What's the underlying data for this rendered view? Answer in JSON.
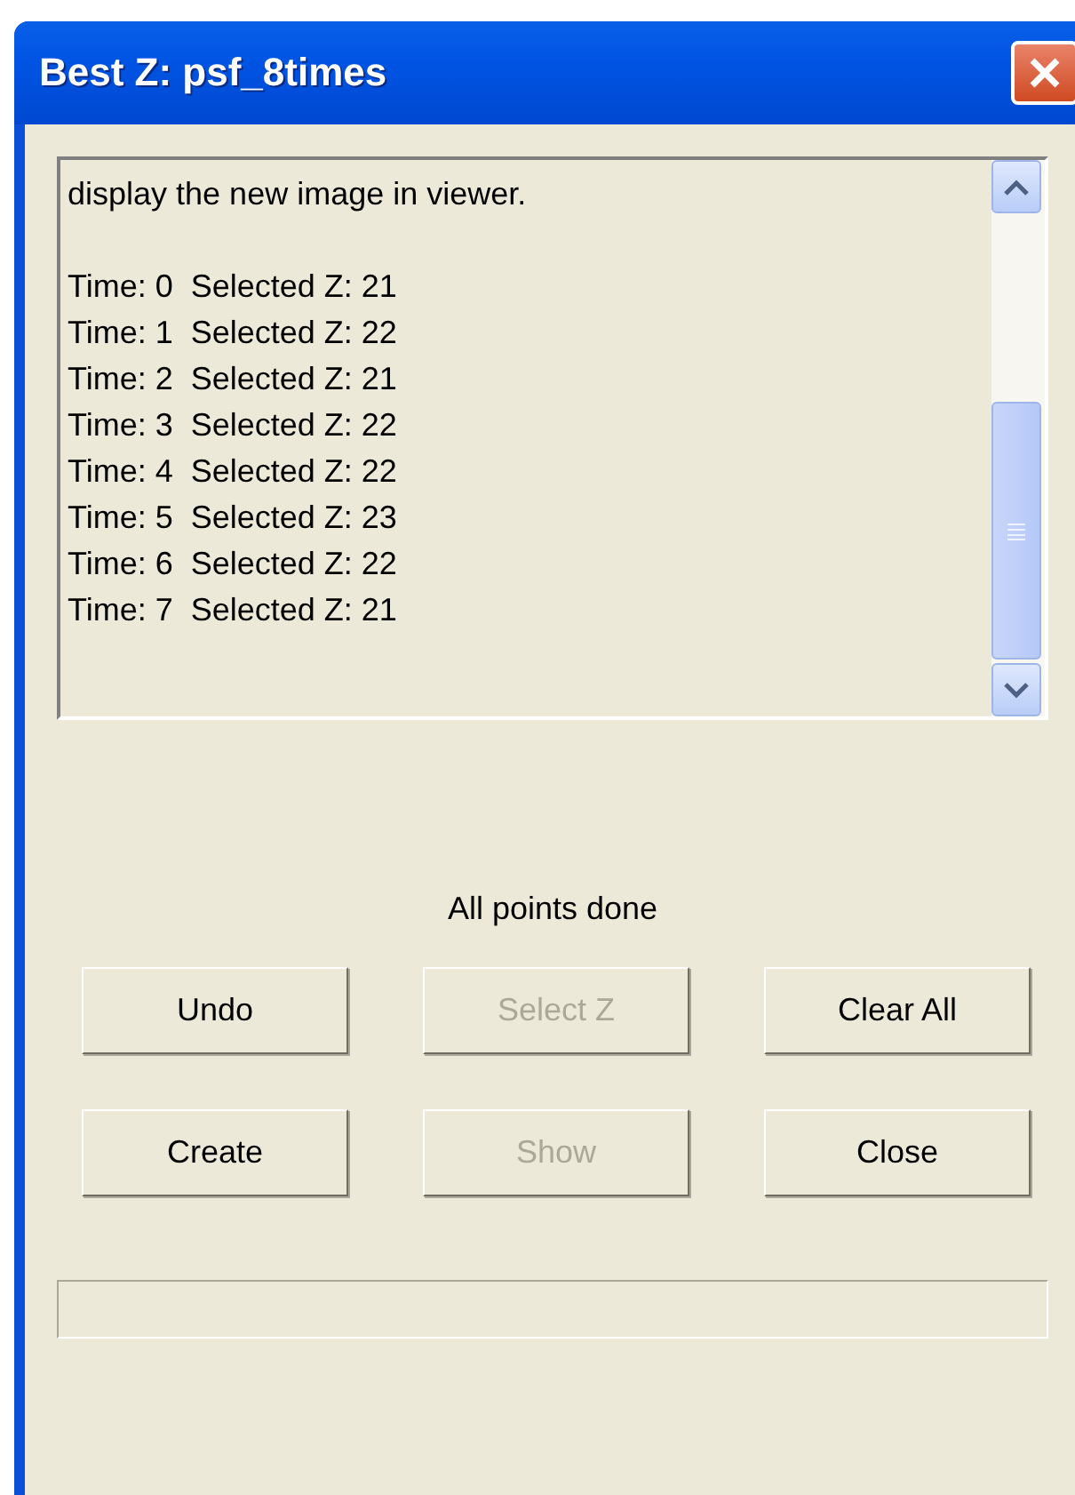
{
  "window": {
    "title": "Best Z: psf_8times"
  },
  "log": {
    "intro": "display the new image in viewer.",
    "lines": [
      "Time: 0  Selected Z: 21",
      "Time: 1  Selected Z: 22",
      "Time: 2  Selected Z: 21",
      "Time: 3  Selected Z: 22",
      "Time: 4  Selected Z: 22",
      "Time: 5  Selected Z: 23",
      "Time: 6  Selected Z: 22",
      "Time: 7  Selected Z: 21"
    ]
  },
  "status": "All points done",
  "buttons": [
    {
      "label": "Undo",
      "disabled": false
    },
    {
      "label": "Select Z",
      "disabled": true
    },
    {
      "label": "Clear All",
      "disabled": false
    },
    {
      "label": "Create",
      "disabled": false
    },
    {
      "label": "Show",
      "disabled": true
    },
    {
      "label": "Close",
      "disabled": false
    }
  ]
}
